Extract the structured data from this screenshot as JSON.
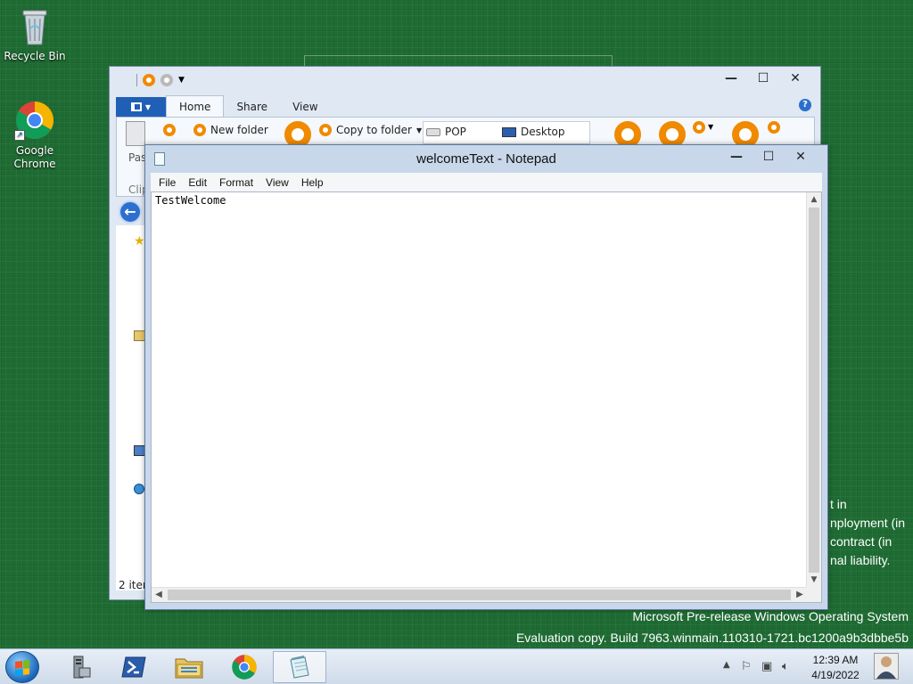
{
  "desktop": {
    "icons": [
      {
        "label": "Recycle Bin"
      },
      {
        "label": "Google Chrome"
      }
    ],
    "background_text": [
      "t in",
      "nployment (in",
      "contract (in",
      "nal liability."
    ],
    "watermark": {
      "line1": "Microsoft Pre-release Windows Operating System",
      "line2": "Evaluation copy. Build 7963.winmain.110310-1721.bc1200a9b3dbbe5b"
    },
    "background_color": "#1d6b32"
  },
  "explorer": {
    "tabs": [
      {
        "label": "Home",
        "active": true
      },
      {
        "label": "Share",
        "active": false
      },
      {
        "label": "View",
        "active": false
      }
    ],
    "ribbon": {
      "paste_label": "Past",
      "clipboard_label": "Clip",
      "new_folder": "New folder",
      "copy_to_folder": "Copy to folder",
      "locations": [
        "POP",
        "Desktop"
      ]
    },
    "status": "2 item",
    "controls": {
      "minimize": "—",
      "maximize": "☐",
      "close": "✕"
    }
  },
  "notepad": {
    "title": "welcomeText - Notepad",
    "menu": [
      "File",
      "Edit",
      "Format",
      "View",
      "Help"
    ],
    "content": "TestWelcome",
    "controls": {
      "minimize": "—",
      "maximize": "☐",
      "close": "✕"
    }
  },
  "taskbar": {
    "apps": [
      {
        "name": "server-manager-icon",
        "active": false
      },
      {
        "name": "powershell-icon",
        "active": false
      },
      {
        "name": "file-explorer-icon",
        "active": false
      },
      {
        "name": "chrome-icon",
        "active": false
      },
      {
        "name": "notepad-icon",
        "active": true
      }
    ],
    "clock": {
      "time": "12:39 AM",
      "date": "4/19/2022"
    }
  }
}
